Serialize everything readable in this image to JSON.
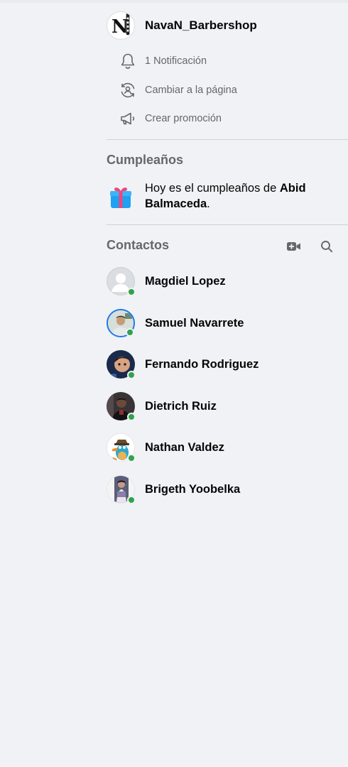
{
  "page": {
    "name": "NavaN_Barbershop",
    "logo_text": "N"
  },
  "actions": [
    {
      "label": "1 Notificación",
      "icon": "bell-icon"
    },
    {
      "label": "Cambiar a la página",
      "icon": "switch-profile-icon"
    },
    {
      "label": "Crear promoción",
      "icon": "megaphone-icon"
    }
  ],
  "birthdays": {
    "title": "Cumpleaños",
    "text_before": "Hoy es el cumpleaños de ",
    "name": "Abid Balmaceda",
    "text_after": "."
  },
  "contacts": {
    "title": "Contactos",
    "items": [
      {
        "name": "Magdiel Lopez",
        "online": true
      },
      {
        "name": "Samuel Navarrete",
        "online": true
      },
      {
        "name": "Fernando Rodriguez",
        "online": true
      },
      {
        "name": "Dietrich Ruiz",
        "online": true
      },
      {
        "name": "Nathan Valdez",
        "online": true
      },
      {
        "name": "Brigeth Yoobelka",
        "online": true
      }
    ]
  },
  "colors": {
    "background": "#f0f2f5",
    "secondary_text": "#65676b",
    "online": "#31a24c"
  }
}
